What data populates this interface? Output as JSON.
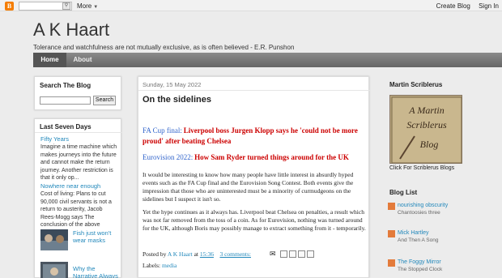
{
  "navbar": {
    "more_label": "More",
    "create_blog": "Create Blog",
    "sign_in": "Sign In"
  },
  "header": {
    "title": "A K Haart",
    "description": "Tolerance and watchfulness are not mutually exclusive, as is often believed - E.R. Punshon"
  },
  "tabs": [
    {
      "label": "Home"
    },
    {
      "label": "About"
    }
  ],
  "sidebar_left": {
    "search": {
      "title": "Search The Blog",
      "button": "Search"
    },
    "last_seven": {
      "title": "Last Seven Days",
      "items": [
        {
          "title": "Fifty Years",
          "snippet": "Imagine a time machine which makes journeys into the future and cannot make the return journey. Another restriction is that it only op..."
        },
        {
          "title": "Nowhere near enough",
          "snippet": "Cost of living: Plans to cut 90,000 civil servants is not a return to austerity, Jacob Rees-Mogg says The conclusion of the above headli..."
        },
        {
          "title": "Fish just won't wear masks",
          "snippet": ""
        },
        {
          "title": "Why the Narrative Always",
          "snippet": ""
        }
      ]
    }
  },
  "post": {
    "date": "Sunday, 15 May 2022",
    "title": "On the sidelines",
    "link1_prefix": "FA Cup final:",
    "link1_text": "Liverpool boss Jurgen Klopp says he 'could not be more proud' after beating Chelsea",
    "link2_prefix": "Eurovision 2022:",
    "link2_text": "How Sam Ryder turned things around for the UK",
    "para1": "It would be interesting to know how many people have little interest in absurdly hyped events such as the FA Cup final and the Eurovision Song Contest. Both events give the impression that those who are uninterested must be a minority of curmudgeons on the sidelines but I suspect it isn't so.",
    "para2": "Yet the hype continues as it always has. Liverpool beat Chelsea on penalties, a result which was not far removed from the toss of a coin. As for Eurovision, nothing was turned around for the UK, although Boris may possibly manage to extract something from it - temporarily.",
    "posted_by": "Posted by",
    "author": "A K Haart",
    "at": "at",
    "time": "15:36",
    "comments": "3 comments:",
    "labels_label": "Labels:",
    "label": "media"
  },
  "sidebar_right": {
    "scriblerus": {
      "title": "Martin Scriblerus",
      "image_text": "A Martin Scriblerus Blog",
      "caption": "Click For Scriblerus Blogs"
    },
    "blog_list": {
      "title": "Blog List",
      "items": [
        {
          "name": "nourishing obscurity",
          "sub": "Chantoosies three"
        },
        {
          "name": "Mick Hartley",
          "sub": "And Then A Song"
        },
        {
          "name": "The Foggy Mirror",
          "sub": "The Stopped Clock"
        }
      ]
    }
  },
  "colors": {
    "link": "#2288bb",
    "red_link": "#cc0000",
    "blue_link": "#3366cc",
    "tab_bg": "#666666",
    "blogger": "#f57d00"
  }
}
